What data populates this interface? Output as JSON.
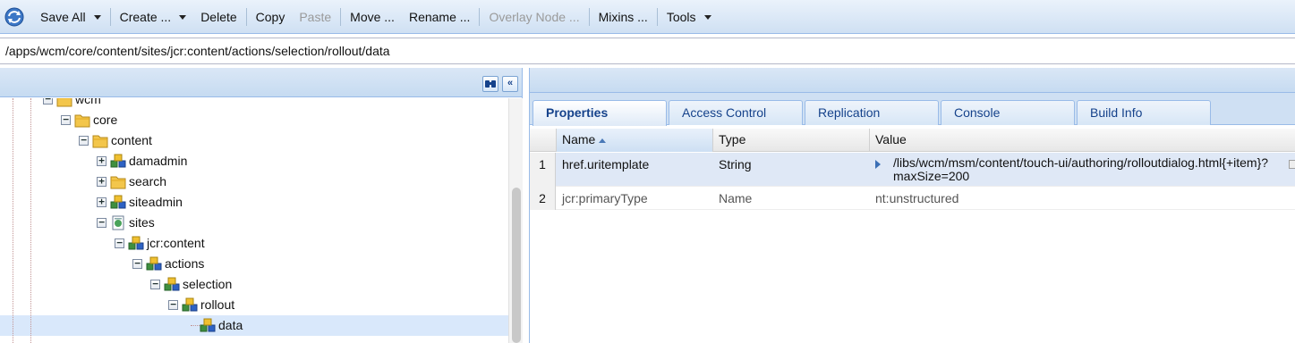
{
  "toolbar": {
    "app_icon": "refresh-icon",
    "items": [
      {
        "label": "Save All",
        "dropdown": true,
        "disabled": false,
        "name": "save-all-button"
      },
      {
        "label": "Create ...",
        "dropdown": true,
        "disabled": false,
        "name": "create-button"
      },
      {
        "label": "Delete",
        "dropdown": false,
        "disabled": false,
        "name": "delete-button"
      },
      {
        "label": "Copy",
        "dropdown": false,
        "disabled": false,
        "name": "copy-button"
      },
      {
        "label": "Paste",
        "dropdown": false,
        "disabled": true,
        "name": "paste-button"
      },
      {
        "label": "Move ...",
        "dropdown": false,
        "disabled": false,
        "name": "move-button"
      },
      {
        "label": "Rename ...",
        "dropdown": false,
        "disabled": false,
        "name": "rename-button"
      },
      {
        "label": "Overlay Node ...",
        "dropdown": false,
        "disabled": true,
        "name": "overlay-node-button"
      },
      {
        "label": "Mixins ...",
        "dropdown": false,
        "disabled": false,
        "name": "mixins-button"
      },
      {
        "label": "Tools",
        "dropdown": true,
        "disabled": false,
        "name": "tools-button"
      }
    ]
  },
  "address": {
    "path": "/apps/wcm/core/content/sites/jcr:content/actions/selection/rollout/data"
  },
  "tree": {
    "nodes": [
      {
        "label": "wcm",
        "icon": "folder",
        "expanded": true,
        "selected": false
      },
      {
        "label": "core",
        "icon": "folder",
        "expanded": true,
        "selected": false
      },
      {
        "label": "content",
        "icon": "folder",
        "expanded": true,
        "selected": false
      },
      {
        "label": "damadmin",
        "icon": "node",
        "expanded": false,
        "selected": false
      },
      {
        "label": "search",
        "icon": "folder",
        "expanded": false,
        "selected": false
      },
      {
        "label": "siteadmin",
        "icon": "node",
        "expanded": false,
        "selected": false
      },
      {
        "label": "sites",
        "icon": "page",
        "expanded": true,
        "selected": false
      },
      {
        "label": "jcr:content",
        "icon": "node",
        "expanded": true,
        "selected": false
      },
      {
        "label": "actions",
        "icon": "node",
        "expanded": true,
        "selected": false
      },
      {
        "label": "selection",
        "icon": "node",
        "expanded": true,
        "selected": false
      },
      {
        "label": "rollout",
        "icon": "node",
        "expanded": true,
        "selected": false
      },
      {
        "label": "data",
        "icon": "node",
        "expanded": null,
        "selected": true
      }
    ]
  },
  "tabs": [
    {
      "label": "Properties",
      "active": true
    },
    {
      "label": "Access Control",
      "active": false
    },
    {
      "label": "Replication",
      "active": false
    },
    {
      "label": "Console",
      "active": false
    },
    {
      "label": "Build Info",
      "active": false
    }
  ],
  "grid": {
    "columns": [
      "Name",
      "Type",
      "Value"
    ],
    "sorted_column": "Name",
    "rows": [
      {
        "num": "1",
        "name": "href.uritemplate",
        "type": "String",
        "value_line1": "/libs/wcm/msm/content/touch-ui/authoring/rolloutdialog.html{+item}?",
        "value_line2": "maxSize=200",
        "selected": true,
        "protected": false
      },
      {
        "num": "2",
        "name": "jcr:primaryType",
        "type": "Name",
        "value_line1": "nt:unstructured",
        "value_line2": "",
        "selected": false,
        "protected": true
      }
    ]
  },
  "colors": {
    "toolbar_bg": "#cfe0f3",
    "selection": "#d9e8fb",
    "tab_text": "#15428b"
  }
}
